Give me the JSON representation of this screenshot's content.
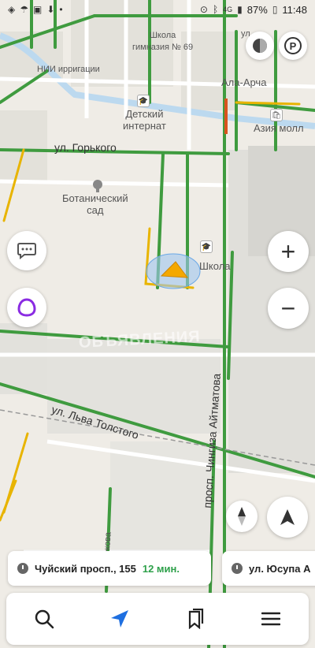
{
  "status_bar": {
    "time": "11:48",
    "battery": "87%",
    "network": "4G"
  },
  "map_labels": {
    "school_69": "Школа\nгимназия № 69",
    "nii": "НИИ ирригации",
    "kindergarten": "Детский\nинтернат",
    "gorky_street": "ул. Горького",
    "botanical_garden": "Ботанический\nсад",
    "school": "Школа",
    "ala_archa": "Ала-Арча",
    "asia_mall": "Азия молл",
    "tolstoy_street": "ул. Льва Толстого",
    "aitmatov_ave": "просп. Чингиза Айтматова",
    "watermark": "ОБЪЯВЛЕНИЯ",
    "partial_street_top": "ул.",
    "partial_street_left": "ул. Т...бекова"
  },
  "route_cards": [
    {
      "destination": "Чуйский просп., 155",
      "eta": "12 мин."
    },
    {
      "destination": "ул. Юсупа А",
      "eta": ""
    }
  ],
  "colors": {
    "road_green": "#3f9b3f",
    "road_yellow": "#e8b400",
    "road_red": "#d9531e",
    "accent_blue": "#1e6fe0",
    "eta_green": "#2ea04a",
    "alice_purple": "#8a2be2",
    "arrow_orange": "#f4a800"
  }
}
